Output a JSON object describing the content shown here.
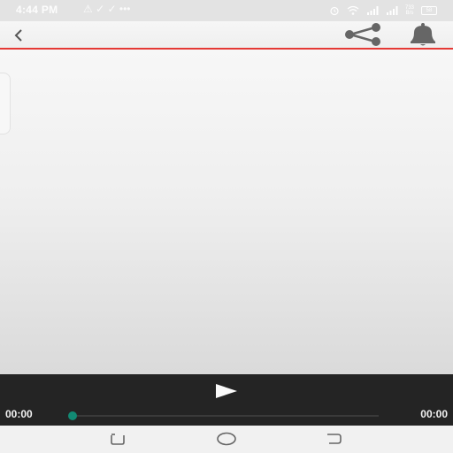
{
  "status_bar": {
    "time": "4:44 PM",
    "notification_icons": "⚠ ✓ ✓ •••",
    "net_speed_value": "733",
    "net_speed_unit": "B/s",
    "battery": "58"
  },
  "player": {
    "current_time": "00:00",
    "total_time": "00:00",
    "progress": 0
  },
  "colors": {
    "accent_red": "#e53935",
    "seek_thumb": "#128a74",
    "player_bg": "#242424"
  }
}
